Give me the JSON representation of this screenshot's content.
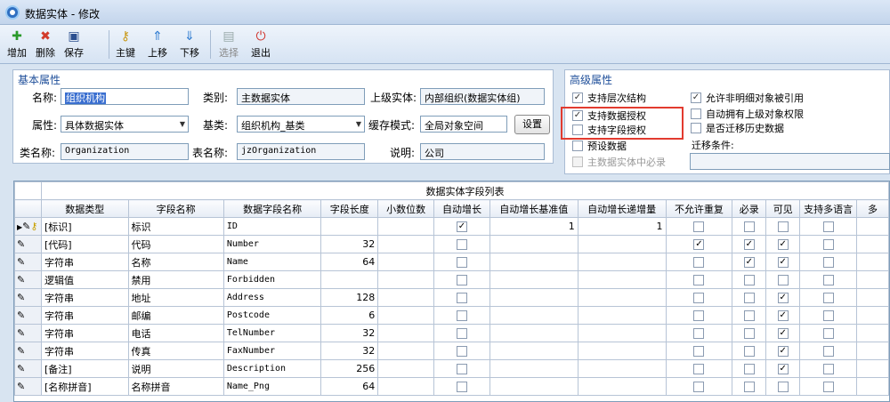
{
  "window": {
    "title": "数据实体 - 修改"
  },
  "toolbar": {
    "items": [
      {
        "label": "增加",
        "icon": "add-icon",
        "enabled": true
      },
      {
        "label": "删除",
        "icon": "delete-icon",
        "enabled": true
      },
      {
        "label": "保存",
        "icon": "save-icon",
        "enabled": true
      },
      {
        "label": "主键",
        "icon": "key-icon",
        "enabled": true
      },
      {
        "label": "上移",
        "icon": "move-up-icon",
        "enabled": true
      },
      {
        "label": "下移",
        "icon": "move-down-icon",
        "enabled": true
      },
      {
        "label": "选择",
        "icon": "select-icon",
        "enabled": false
      },
      {
        "label": "退出",
        "icon": "exit-icon",
        "enabled": true
      }
    ]
  },
  "basic": {
    "title": "基本属性",
    "name_label": "名称:",
    "name_value": "组织机构",
    "category_label": "类别:",
    "category_value": "主数据实体",
    "parent_label": "上级实体:",
    "parent_value": "内部组织(数据实体组)",
    "attr_label": "属性:",
    "attr_value": "具体数据实体",
    "base_label": "基类:",
    "base_value": "组织机构_基类",
    "cache_label": "缓存模式:",
    "cache_value": "全局对象空间",
    "settings_button": "设置",
    "classname_label": "类名称:",
    "classname_value": "Organization",
    "tablename_label": "表名称:",
    "tablename_value": "jzOrganization",
    "desc_label": "说明:",
    "desc_value": "公司"
  },
  "advanced": {
    "title": "高级属性",
    "opt_hierarchy": "支持层次结构",
    "opt_hierarchy_checked": "✓",
    "opt_data_auth": "支持数据授权",
    "opt_data_auth_checked": "✓",
    "opt_field_auth": "支持字段授权",
    "opt_field_auth_checked": "",
    "opt_preset": "预设数据",
    "opt_preset_checked": "",
    "opt_required": "主数据实体中必录",
    "opt_required_checked": "",
    "opt_nondetail": "允许非明细对象被引用",
    "opt_nondetail_checked": "✓",
    "opt_auto_parent": "自动拥有上级对象权限",
    "opt_auto_parent_checked": "",
    "opt_migrate": "是否迁移历史数据",
    "opt_migrate_checked": "",
    "migrate_cond_label": "迁移条件:"
  },
  "grid": {
    "caption": "数据实体字段列表",
    "columns": [
      "数据类型",
      "字段名称",
      "数据字段名称",
      "字段长度",
      "小数位数",
      "自动增长",
      "自动增长基准值",
      "自动增长递增量",
      "不允许重复",
      "必录",
      "可见",
      "支持多语言",
      "多"
    ],
    "rows": [
      {
        "type": "[标识]",
        "name": "标识",
        "db": "ID",
        "len": "",
        "dec": "",
        "auto": "✓",
        "base": "1",
        "inc": "1",
        "uniq": "",
        "req": "",
        "vis": "",
        "ml": "",
        "key": "⚷"
      },
      {
        "type": "[代码]",
        "name": "代码",
        "db": "Number",
        "len": "32",
        "dec": "",
        "auto": "",
        "base": "",
        "inc": "",
        "uniq": "✓",
        "req": "✓",
        "vis": "✓",
        "ml": "",
        "key": ""
      },
      {
        "type": "字符串",
        "name": "名称",
        "db": "Name",
        "len": "64",
        "dec": "",
        "auto": "",
        "base": "",
        "inc": "",
        "uniq": "",
        "req": "✓",
        "vis": "✓",
        "ml": "",
        "key": ""
      },
      {
        "type": "逻辑值",
        "name": "禁用",
        "db": "Forbidden",
        "len": "",
        "dec": "",
        "auto": "",
        "base": "",
        "inc": "",
        "uniq": "",
        "req": "",
        "vis": "",
        "ml": "",
        "key": ""
      },
      {
        "type": "字符串",
        "name": "地址",
        "db": "Address",
        "len": "128",
        "dec": "",
        "auto": "",
        "base": "",
        "inc": "",
        "uniq": "",
        "req": "",
        "vis": "✓",
        "ml": "",
        "key": ""
      },
      {
        "type": "字符串",
        "name": "邮编",
        "db": "Postcode",
        "len": "6",
        "dec": "",
        "auto": "",
        "base": "",
        "inc": "",
        "uniq": "",
        "req": "",
        "vis": "✓",
        "ml": "",
        "key": ""
      },
      {
        "type": "字符串",
        "name": "电话",
        "db": "TelNumber",
        "len": "32",
        "dec": "",
        "auto": "",
        "base": "",
        "inc": "",
        "uniq": "",
        "req": "",
        "vis": "✓",
        "ml": "",
        "key": ""
      },
      {
        "type": "字符串",
        "name": "传真",
        "db": "FaxNumber",
        "len": "32",
        "dec": "",
        "auto": "",
        "base": "",
        "inc": "",
        "uniq": "",
        "req": "",
        "vis": "✓",
        "ml": "",
        "key": ""
      },
      {
        "type": "[备注]",
        "name": "说明",
        "db": "Description",
        "len": "256",
        "dec": "",
        "auto": "",
        "base": "",
        "inc": "",
        "uniq": "",
        "req": "",
        "vis": "✓",
        "ml": "",
        "key": ""
      },
      {
        "type": "[名称拼音]",
        "name": "名称拼音",
        "db": "Name_Png",
        "len": "64",
        "dec": "",
        "auto": "",
        "base": "",
        "inc": "",
        "uniq": "",
        "req": "",
        "vis": "",
        "ml": "",
        "key": ""
      }
    ]
  }
}
